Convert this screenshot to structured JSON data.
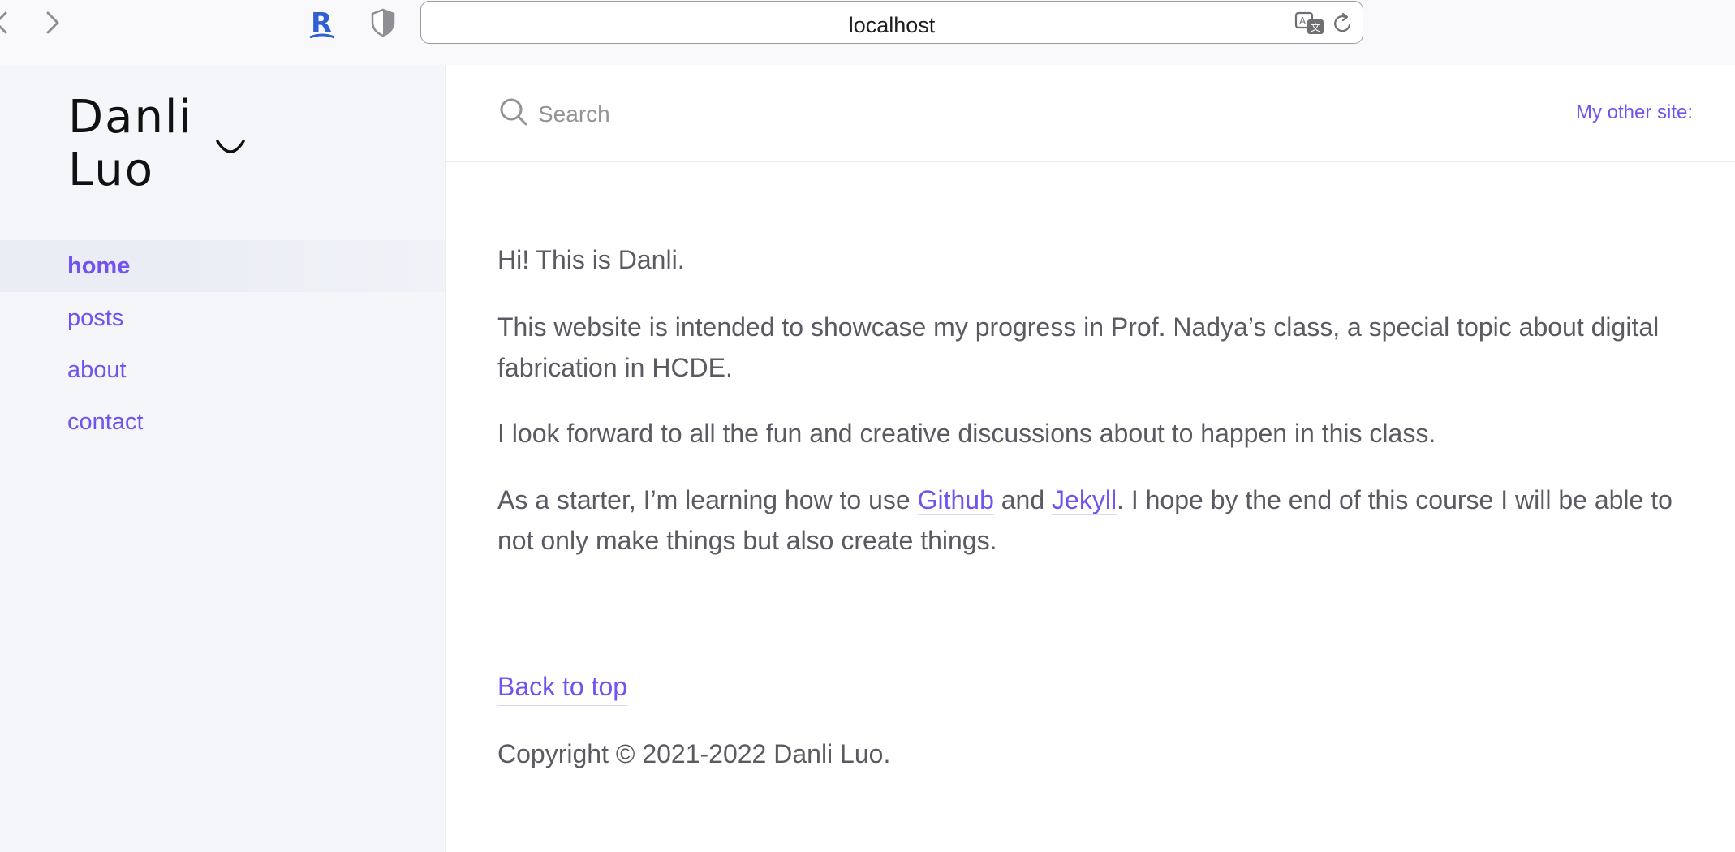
{
  "browser": {
    "url": "localhost",
    "icons": [
      "chevron-left-icon",
      "chevron-right-icon",
      "r-extension-icon",
      "shield-icon",
      "translate-icon",
      "reload-icon"
    ]
  },
  "sidebar": {
    "logo_text": "Danli Luo",
    "nav": [
      {
        "label": "home",
        "active": true
      },
      {
        "label": "posts",
        "active": false
      },
      {
        "label": "about",
        "active": false
      },
      {
        "label": "contact",
        "active": false
      }
    ]
  },
  "header": {
    "search_placeholder": "Search",
    "aux_link": "My other site:"
  },
  "content": {
    "greeting": "Hi! This is Danli.",
    "intro": "This website is intended to showcase my progress in Prof. Nadya’s class, a special topic about digital fabrication in HCDE.",
    "forward": "I look forward to all the fun and creative discussions about to happen in this class.",
    "starter_prefix": "As a starter, I’m learning how to use ",
    "github_link": "Github",
    "and_word": " and ",
    "jekyll_link": "Jekyll",
    "starter_suffix": ". I hope by the end of this course I will be able to not only make things but also create things."
  },
  "footer": {
    "back_to_top": "Back to top",
    "copyright": "Copyright © 2021-2022 Danli Luo."
  },
  "colors": {
    "accent": "#7253ed",
    "text": "#5c5962",
    "sidebar_bg": "#f5f6fa",
    "active_bg": "#ebedf5",
    "border": "#eeebee"
  }
}
